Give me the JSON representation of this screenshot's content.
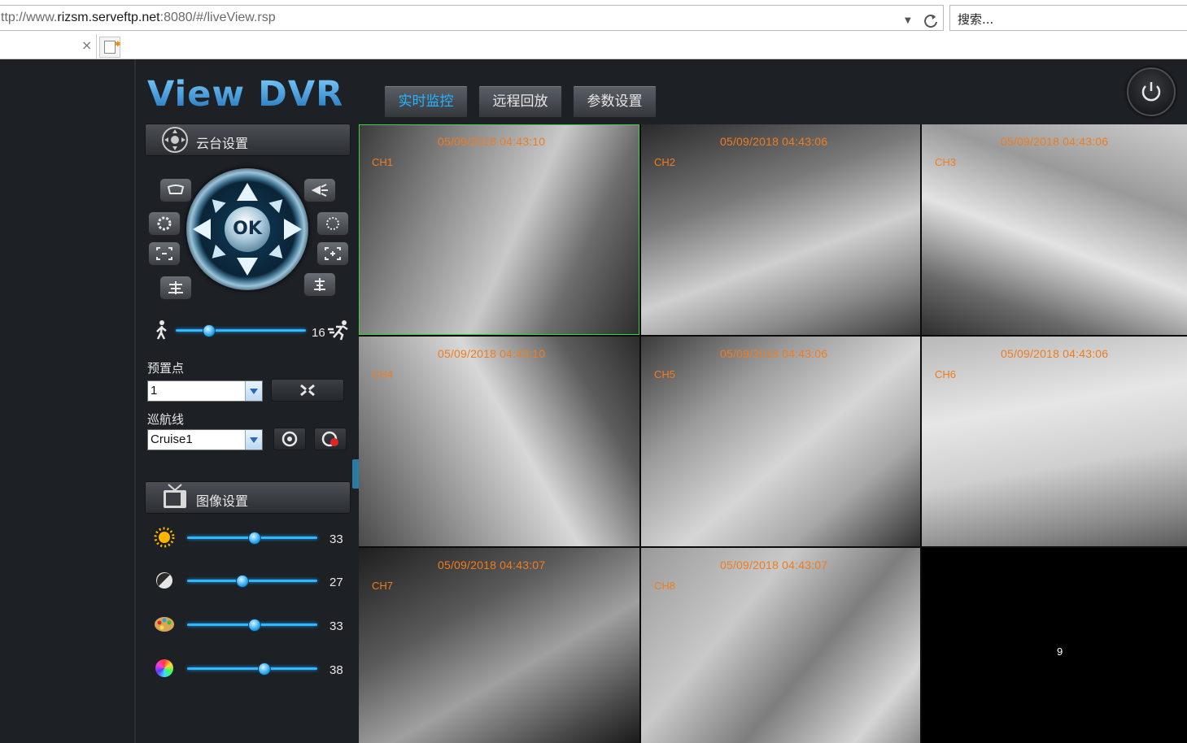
{
  "browser": {
    "url_prefix": "ttp://www.",
    "url_host": "rizsm.serveftp.net",
    "url_rest": ":8080/#/liveView.rsp",
    "search_placeholder": "搜索...",
    "tab_close": "×"
  },
  "app": {
    "logo": "View DVR",
    "tabs": [
      {
        "label": "实时监控",
        "active": true
      },
      {
        "label": "远程回放",
        "active": false
      },
      {
        "label": "参数设置",
        "active": false
      }
    ]
  },
  "ptz": {
    "title": "云台设置",
    "ok_label": "OK",
    "speed": 16,
    "speed_max": 64,
    "preset_label": "预置点",
    "preset_value": "1",
    "cruise_label": "巡航线",
    "cruise_value": "Cruise1"
  },
  "image": {
    "title": "图像设置",
    "sliders": [
      {
        "icon": "brightness-icon",
        "value": 33
      },
      {
        "icon": "contrast-icon",
        "value": 27
      },
      {
        "icon": "saturation-icon",
        "value": 33
      },
      {
        "icon": "hue-icon",
        "value": 38
      }
    ],
    "slider_max": 100
  },
  "cameras": [
    {
      "ch": "CH1",
      "ts": "05/09/2018 04:43:10",
      "selected": true
    },
    {
      "ch": "CH2",
      "ts": "05/09/2018 04:43:06"
    },
    {
      "ch": "CH3",
      "ts": "05/09/2018 04:43:06"
    },
    {
      "ch": "CH4",
      "ts": "05/09/2018 04:43:10"
    },
    {
      "ch": "CH5",
      "ts": "05/09/2018 04:43:06"
    },
    {
      "ch": "CH6",
      "ts": "05/09/2018 04:43:06"
    },
    {
      "ch": "CH7",
      "ts": "05/09/2018 04:43:07"
    },
    {
      "ch": "CH8",
      "ts": "05/09/2018 04:43:07"
    },
    {
      "ch": "",
      "ts": "",
      "empty_label": "9"
    }
  ],
  "colors": {
    "accent": "#23b4ff",
    "overlay_text": "#f07c1e",
    "selected_border": "#3ad43a"
  }
}
